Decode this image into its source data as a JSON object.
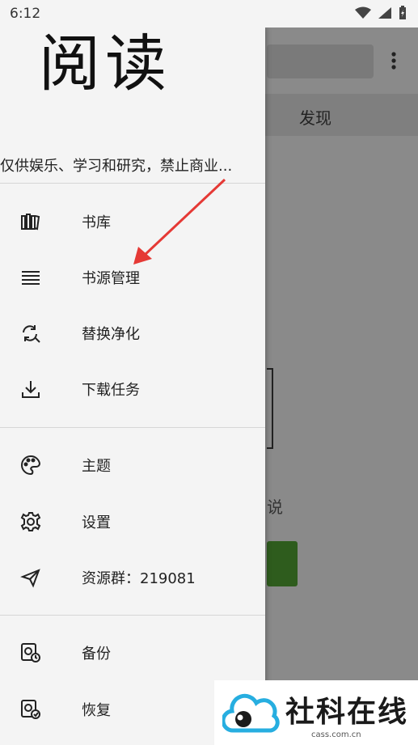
{
  "status_bar": {
    "time": "6:12"
  },
  "background": {
    "tab_label": "发现",
    "text_fragment": "说"
  },
  "drawer": {
    "logo": "阅读",
    "tagline": "仅供娱乐、学习和研究，禁止商业...",
    "items": [
      {
        "label": "书库",
        "icon": "bookshelf-icon"
      },
      {
        "label": "书源管理",
        "icon": "list-icon"
      },
      {
        "label": "替换净化",
        "icon": "replace-icon"
      },
      {
        "label": "下载任务",
        "icon": "download-icon"
      },
      {
        "label": "主题",
        "icon": "palette-icon"
      },
      {
        "label": "设置",
        "icon": "gear-icon"
      },
      {
        "label": "资源群：219081",
        "icon": "send-icon"
      },
      {
        "label": "备份",
        "icon": "backup-icon"
      },
      {
        "label": "恢复",
        "icon": "restore-icon"
      }
    ]
  },
  "watermark": {
    "text": "社科在线",
    "url": "cass.com.cn"
  },
  "colors": {
    "arrow": "#e53935",
    "accent_button": "#2e5c1d",
    "drawer_bg": "#f4f4f4"
  }
}
